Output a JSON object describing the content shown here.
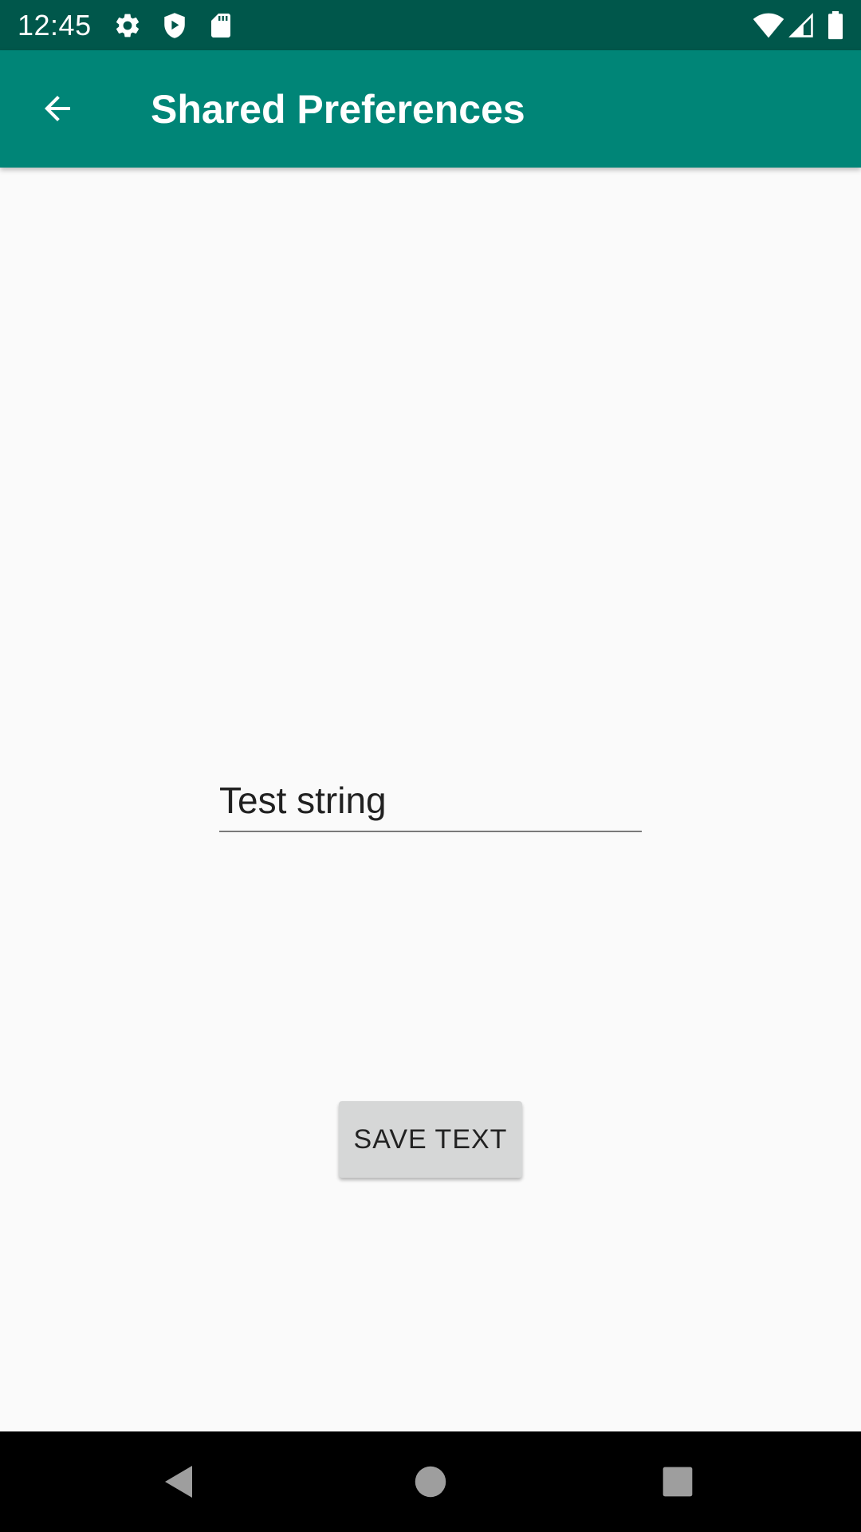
{
  "status_bar": {
    "time": "12:45",
    "left_icons": [
      "gear-icon",
      "shield-play-icon",
      "sd-card-icon"
    ],
    "right_icons": [
      "wifi-icon",
      "cell-signal-icon",
      "battery-icon"
    ]
  },
  "app_bar": {
    "title": "Shared Preferences",
    "back_icon": "arrow-back-icon",
    "background": "#008577",
    "status_background": "#00574b"
  },
  "content": {
    "text_input_value": "Test string",
    "save_button_label": "SAVE TEXT"
  },
  "nav_bar": {
    "buttons": [
      "back-triangle-icon",
      "home-circle-icon",
      "recents-square-icon"
    ]
  }
}
